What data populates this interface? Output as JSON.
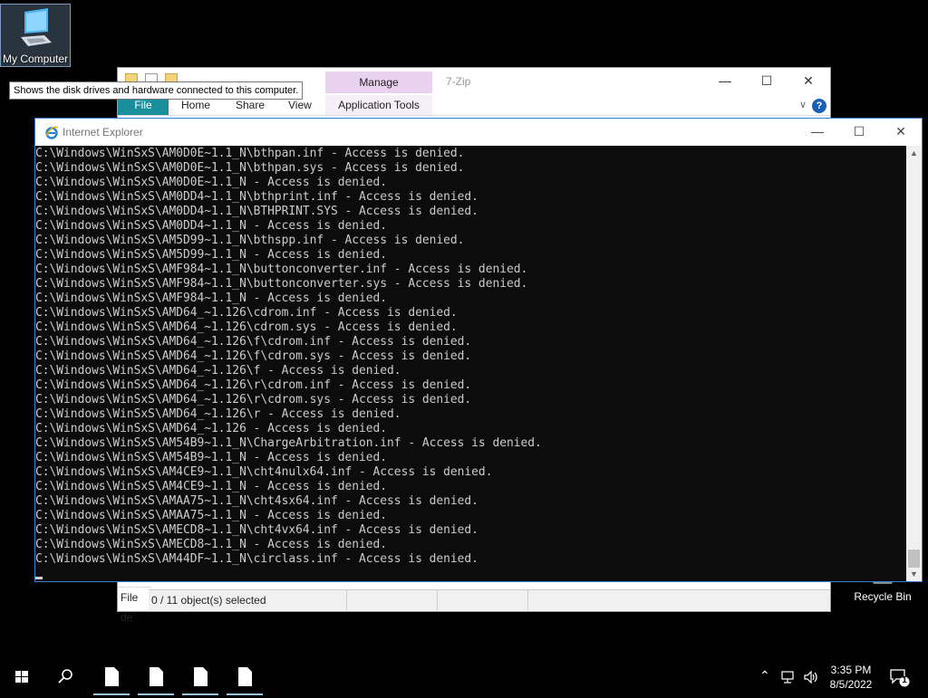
{
  "desktop": {
    "icons": [
      {
        "label": "My Computer"
      },
      {
        "label": "Recycle Bin"
      }
    ],
    "tooltip": "Shows the disk drives and hardware connected to this computer."
  },
  "explorer": {
    "title": "7-Zip",
    "manage_tab": "Manage",
    "ribbon_tabs": [
      "File",
      "Home",
      "Share",
      "View",
      "Application Tools"
    ],
    "left_status": "File de",
    "status": "0 / 11 object(s) selected"
  },
  "console": {
    "title": "Internet Explorer",
    "lines": [
      "C:\\Windows\\WinSxS\\AM0D0E~1.1_N\\bthpan.inf - Access is denied.",
      "C:\\Windows\\WinSxS\\AM0D0E~1.1_N\\bthpan.sys - Access is denied.",
      "C:\\Windows\\WinSxS\\AM0D0E~1.1_N - Access is denied.",
      "C:\\Windows\\WinSxS\\AM0DD4~1.1_N\\bthprint.inf - Access is denied.",
      "C:\\Windows\\WinSxS\\AM0DD4~1.1_N\\BTHPRINT.SYS - Access is denied.",
      "C:\\Windows\\WinSxS\\AM0DD4~1.1_N - Access is denied.",
      "C:\\Windows\\WinSxS\\AM5D99~1.1_N\\bthspp.inf - Access is denied.",
      "C:\\Windows\\WinSxS\\AM5D99~1.1_N - Access is denied.",
      "C:\\Windows\\WinSxS\\AMF984~1.1_N\\buttonconverter.inf - Access is denied.",
      "C:\\Windows\\WinSxS\\AMF984~1.1_N\\buttonconverter.sys - Access is denied.",
      "C:\\Windows\\WinSxS\\AMF984~1.1_N - Access is denied.",
      "C:\\Windows\\WinSxS\\AMD64_~1.126\\cdrom.inf - Access is denied.",
      "C:\\Windows\\WinSxS\\AMD64_~1.126\\cdrom.sys - Access is denied.",
      "C:\\Windows\\WinSxS\\AMD64_~1.126\\f\\cdrom.inf - Access is denied.",
      "C:\\Windows\\WinSxS\\AMD64_~1.126\\f\\cdrom.sys - Access is denied.",
      "C:\\Windows\\WinSxS\\AMD64_~1.126\\f - Access is denied.",
      "C:\\Windows\\WinSxS\\AMD64_~1.126\\r\\cdrom.inf - Access is denied.",
      "C:\\Windows\\WinSxS\\AMD64_~1.126\\r\\cdrom.sys - Access is denied.",
      "C:\\Windows\\WinSxS\\AMD64_~1.126\\r - Access is denied.",
      "C:\\Windows\\WinSxS\\AMD64_~1.126 - Access is denied.",
      "C:\\Windows\\WinSxS\\AM54B9~1.1_N\\ChargeArbitration.inf - Access is denied.",
      "C:\\Windows\\WinSxS\\AM54B9~1.1_N - Access is denied.",
      "C:\\Windows\\WinSxS\\AM4CE9~1.1_N\\cht4nulx64.inf - Access is denied.",
      "C:\\Windows\\WinSxS\\AM4CE9~1.1_N - Access is denied.",
      "C:\\Windows\\WinSxS\\AMAA75~1.1_N\\cht4sx64.inf - Access is denied.",
      "C:\\Windows\\WinSxS\\AMAA75~1.1_N - Access is denied.",
      "C:\\Windows\\WinSxS\\AMECD8~1.1_N\\cht4vx64.inf - Access is denied.",
      "C:\\Windows\\WinSxS\\AMECD8~1.1_N - Access is denied.",
      "C:\\Windows\\WinSxS\\AM44DF~1.1_N\\circlass.inf - Access is denied."
    ]
  },
  "taskbar": {
    "time": "3:35 PM",
    "date": "8/5/2022",
    "notification_count": "1",
    "pinned": [
      "file-icon",
      "file-icon",
      "file-icon",
      "file-icon"
    ]
  },
  "colors": {
    "console_bg": "#0c0c0c",
    "console_text": "#cccccc",
    "file_tab": "#1a8f9c",
    "manage_tab": "#e8d2f0"
  }
}
